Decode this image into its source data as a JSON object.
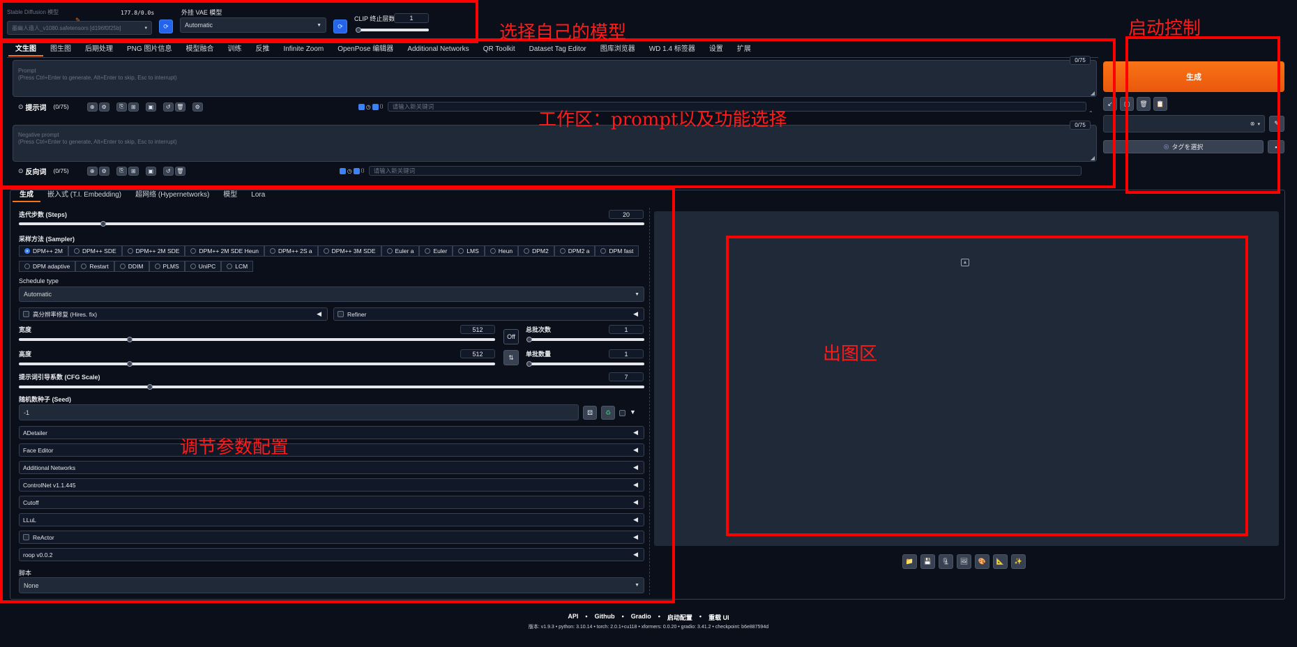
{
  "top": {
    "sd_model_label": "Stable Diffusion 模型",
    "sd_model_value": "墨幽人造人_v1080.safetensors [d196f0f25b]",
    "timing": "177.8/0.0s",
    "vae_label": "外挂 VAE 模型",
    "vae_value": "Automatic",
    "clip_label": "CLIP 终止层数",
    "clip_value": "1"
  },
  "tabs": [
    "文生图",
    "图生图",
    "后期处理",
    "PNG 图片信息",
    "模型融合",
    "训练",
    "反推",
    "Infinite Zoom",
    "OpenPose 编辑器",
    "Additional Networks",
    "QR Toolkit",
    "Dataset Tag Editor",
    "图库浏览器",
    "WD 1.4 标签器",
    "设置",
    "扩展"
  ],
  "prompt": {
    "counter": "0/75",
    "placeholder_line1": "Prompt",
    "placeholder_line2": "(Press Ctrl+Enter to generate, Alt+Enter to skip, Esc to interrupt)",
    "toolbar_label": "提示词",
    "toolbar_count": "(0/75)",
    "keyword_placeholder": "请输入新关键词"
  },
  "negative": {
    "counter": "0/75",
    "placeholder_line1": "Negative prompt",
    "placeholder_line2": "(Press Ctrl+Enter to generate, Alt+Enter to skip, Esc to interrupt)",
    "toolbar_label": "反向词",
    "toolbar_count": "(0/75)",
    "keyword_placeholder": "请输入新关键词"
  },
  "generate": {
    "button": "生成",
    "tag_button": "タグを選択"
  },
  "subtabs": [
    "生成",
    "嵌入式 (T.I. Embedding)",
    "超网络 (Hypernetworks)",
    "模型",
    "Lora"
  ],
  "params": {
    "steps_label": "迭代步数 (Steps)",
    "steps_value": "20",
    "steps_fraction": 0.13,
    "sampler_label": "采样方法 (Sampler)",
    "samplers_row1": [
      "DPM++ 2M",
      "DPM++ SDE",
      "DPM++ 2M SDE",
      "DPM++ 2M SDE Heun",
      "DPM++ 2S a",
      "DPM++ 3M SDE",
      "Euler a",
      "Euler",
      "LMS",
      "Heun",
      "DPM2",
      "DPM2 a",
      "DPM fast"
    ],
    "samplers_row2": [
      "DPM adaptive",
      "Restart",
      "DDIM",
      "PLMS",
      "UniPC",
      "LCM"
    ],
    "sampler_selected": "DPM++ 2M",
    "schedule_label": "Schedule type",
    "schedule_value": "Automatic",
    "hires_label": "高分辨率修复 (Hires. fix)",
    "refiner_label": "Refiner",
    "width_label": "宽度",
    "width_value": "512",
    "height_label": "高度",
    "height_value": "512",
    "off_label": "Off",
    "batch_count_label": "总批次数",
    "batch_count_value": "1",
    "batch_size_label": "单批数量",
    "batch_size_value": "1",
    "cfg_label": "提示词引导系数 (CFG Scale)",
    "cfg_value": "7",
    "seed_label": "随机数种子 (Seed)",
    "seed_value": "-1",
    "accordions": [
      "ADetailer",
      "Face Editor",
      "Additional Networks",
      "ControlNet v1.1.445",
      "Cutoff",
      "LLuL",
      "ReActor",
      "roop v0.0.2"
    ],
    "script_label": "脚本",
    "script_value": "None"
  },
  "footer": {
    "links": [
      "API",
      "Github",
      "Gradio",
      "启动配置",
      "重载 UI"
    ],
    "version": "版本: v1.9.3  •  python: 3.10.14  •  torch: 2.0.1+cu118  •  xformers: 0.0.20  •  gradio: 3.41.2  •  checkpoint: b6e887594d"
  },
  "annotations": {
    "model": "选择自己的模型",
    "launch": "启动控制",
    "workspace": "工作区：prompt以及功能选择",
    "output": "出图区",
    "params": "调节参数配置"
  },
  "colors": {
    "accent": "#f97316",
    "annotation": "#ff0000",
    "background": "#0b0f19"
  }
}
